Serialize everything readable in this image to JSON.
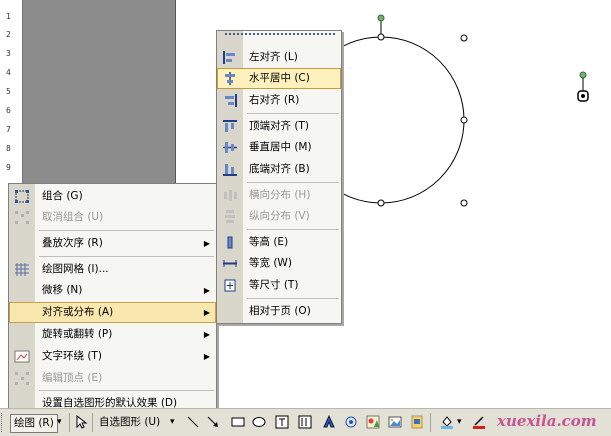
{
  "ruler": {
    "numbers": [
      "1",
      "2",
      "3",
      "4",
      "5",
      "6",
      "7",
      "8",
      "9"
    ]
  },
  "context_menu": {
    "items": [
      {
        "label": "组合 (G)",
        "disabled": false,
        "submenu": false
      },
      {
        "label": "取消组合 (U)",
        "disabled": true,
        "submenu": false
      },
      {
        "label": "叠放次序 (R)",
        "disabled": false,
        "submenu": true
      },
      {
        "label": "绘图网格 (I)...",
        "disabled": false,
        "submenu": false
      },
      {
        "label": "微移 (N)",
        "disabled": false,
        "submenu": true
      },
      {
        "label": "对齐或分布 (A)",
        "disabled": false,
        "submenu": true,
        "highlighted": true
      },
      {
        "label": "旋转或翻转 (P)",
        "disabled": false,
        "submenu": true
      },
      {
        "label": "文字环绕 (T)",
        "disabled": false,
        "submenu": true
      },
      {
        "label": "编辑顶点 (E)",
        "disabled": true,
        "submenu": false
      },
      {
        "label": "设置自选图形的默认效果 (D)",
        "disabled": false,
        "submenu": false
      }
    ]
  },
  "align_submenu": {
    "items": [
      {
        "label": "左对齐 (L)",
        "disabled": false
      },
      {
        "label": "水平居中 (C)",
        "disabled": false,
        "highlighted": true
      },
      {
        "label": "右对齐 (R)",
        "disabled": false
      },
      {
        "label": "顶端对齐 (T)",
        "disabled": false
      },
      {
        "label": "垂直居中 (M)",
        "disabled": false
      },
      {
        "label": "底端对齐 (B)",
        "disabled": false
      },
      {
        "label": "横向分布 (H)",
        "disabled": true
      },
      {
        "label": "纵向分布 (V)",
        "disabled": true
      },
      {
        "label": "等高 (E)",
        "disabled": false
      },
      {
        "label": "等宽 (W)",
        "disabled": false
      },
      {
        "label": "等尺寸 (T)",
        "disabled": false
      },
      {
        "label": "相对于页 (O)",
        "disabled": false
      }
    ]
  },
  "toolbar": {
    "draw_label": "绘图 (R)",
    "dropdown_arrow": "▾",
    "autoshapes_label": "自选图形 (U)",
    "watermark": "xuexila.com"
  },
  "colors": {
    "menu_bg": "#f6f6f3",
    "menu_strip": "#d9d6cc",
    "highlight": "#f9e7b0",
    "toolbar_bg": "#e3e0d6",
    "handle_green": "#6fb36f"
  }
}
